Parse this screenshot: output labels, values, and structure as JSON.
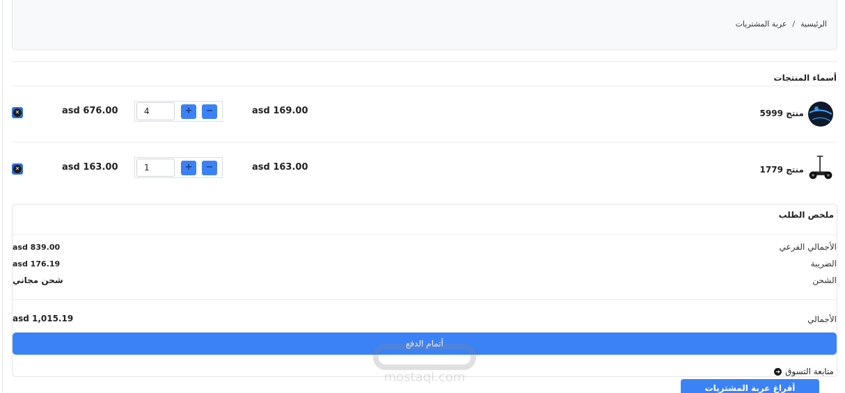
{
  "breadcrumb": {
    "home": "الرئيسية",
    "separator": "/",
    "current": "عربة المشتريات"
  },
  "products_header": "أسماء المنتجات",
  "cart": {
    "items": [
      {
        "name": "منتج 5999",
        "icon": "ball-product-image",
        "unit_price": "asd 169.00",
        "quantity": "4",
        "line_total": "asd 676.00"
      },
      {
        "name": "منتج 1779",
        "icon": "scooter-product-image",
        "unit_price": "asd 163.00",
        "quantity": "1",
        "line_total": "asd 163.00"
      }
    ],
    "plus_label": "+",
    "minus_label": "−"
  },
  "summary": {
    "title": "ملخص الطلب",
    "subtotal_label": "الأجمالي الفرعي",
    "subtotal_value": "asd 839.00",
    "tax_label": "الضريبة",
    "tax_value": "asd 176.19",
    "shipping_label": "الشحن",
    "shipping_value": "شحن مجاني",
    "total_label": "الأجمالي",
    "total_value": "asd 1,015.19",
    "checkout_label": "أتمام الدفع",
    "continue_label": "متابعة التسوق"
  },
  "clear_cart_label": "أفراغ عربة المشتريات",
  "watermark": {
    "text": "mostaql.com"
  },
  "colors": {
    "primary": "#3b82f6",
    "remove": "#2b6fd6",
    "border": "#e3e5e8",
    "panel": "#f8f9fa"
  }
}
